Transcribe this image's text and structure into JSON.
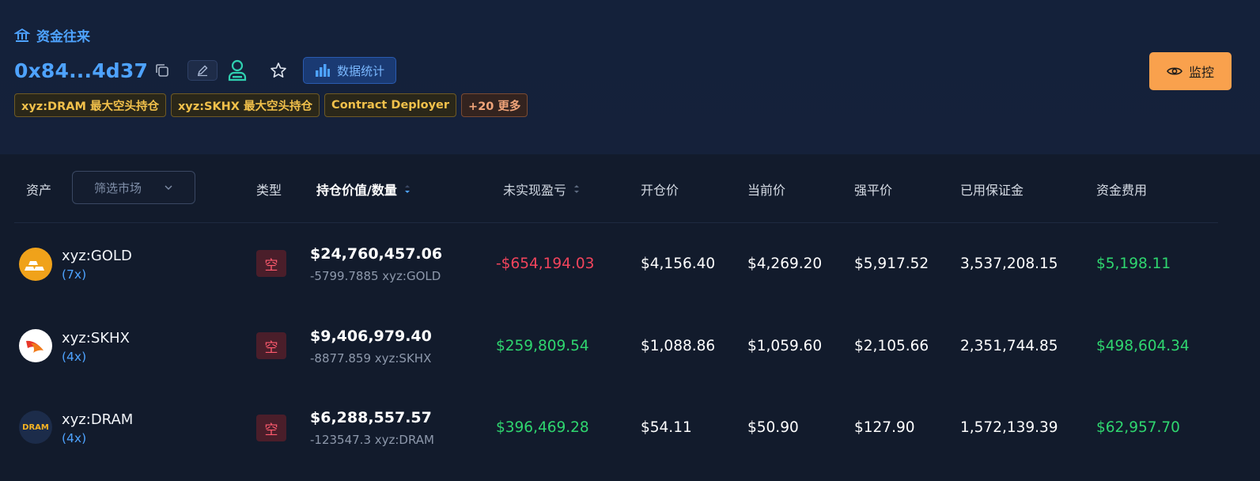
{
  "breadcrumb": {
    "label": "资金往来"
  },
  "profile": {
    "address": "0x84...4d37",
    "stats_label": "数据统计",
    "tags": [
      "xyz:DRAM 最大空头持仓",
      "xyz:SKHX 最大空头持仓",
      "Contract Deployer"
    ],
    "more_tag": "+20 更多",
    "watch_label": "监控"
  },
  "table": {
    "headers": {
      "asset": "资产",
      "filter_placeholder": "筛选市场",
      "type": "类型",
      "position_value": "持仓价值/数量",
      "unrealized_pnl": "未实现盈亏",
      "entry_price": "开仓价",
      "mark_price": "当前价",
      "liq_price": "强平价",
      "margin_used": "已用保证金",
      "funding": "资金费用"
    },
    "rows": [
      {
        "asset": "xyz:GOLD",
        "leverage": "(7x)",
        "icon": "gold-bars-icon",
        "type": "空",
        "value": "$24,760,457.06",
        "qty": "-5799.7885 xyz:GOLD",
        "pnl": "-$654,194.03",
        "pnl_sign": "neg",
        "entry": "$4,156.40",
        "mark": "$4,269.20",
        "liq": "$5,917.52",
        "margin": "3,537,208.15",
        "funding": "$5,198.11"
      },
      {
        "asset": "xyz:SKHX",
        "leverage": "(4x)",
        "icon": "sk-hynix-logo-icon",
        "type": "空",
        "value": "$9,406,979.40",
        "qty": "-8877.859 xyz:SKHX",
        "pnl": "$259,809.54",
        "pnl_sign": "pos",
        "entry": "$1,088.86",
        "mark": "$1,059.60",
        "liq": "$2,105.66",
        "margin": "2,351,744.85",
        "funding": "$498,604.34"
      },
      {
        "asset": "xyz:DRAM",
        "leverage": "(4x)",
        "icon": "dram-logo-icon",
        "icon_text": "DRAM",
        "type": "空",
        "value": "$6,288,557.57",
        "qty": "-123547.3 xyz:DRAM",
        "pnl": "$396,469.28",
        "pnl_sign": "pos",
        "entry": "$54.11",
        "mark": "$50.90",
        "liq": "$127.90",
        "margin": "1,572,139.39",
        "funding": "$62,957.70"
      }
    ]
  },
  "colors": {
    "accent": "#4ea3ff",
    "positive": "#2fd66f",
    "negative": "#f2445c",
    "warning": "#f9a14d",
    "background": "#121b2c"
  }
}
